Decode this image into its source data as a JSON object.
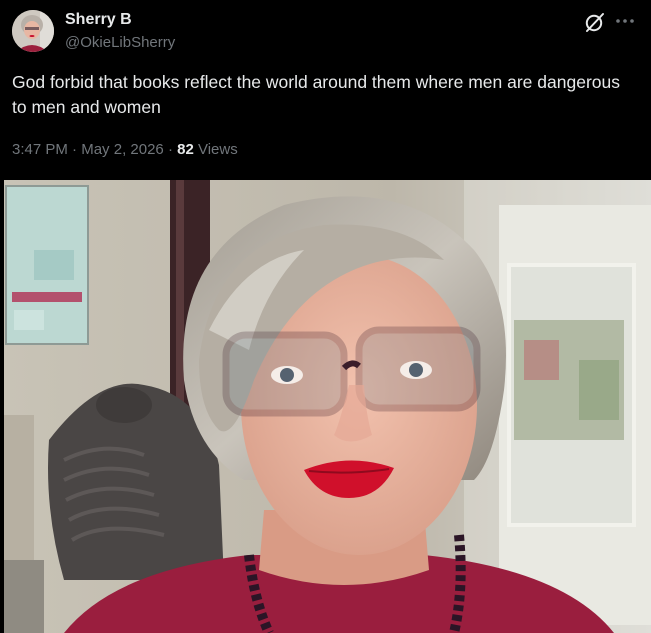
{
  "tweet": {
    "author_name": "Sherry B",
    "author_handle": "@OkieLibSherry",
    "text": "God forbid that books reflect the world around them where men are dangerous to men and women",
    "time": "3:47 PM",
    "separator": "·",
    "date": "May 2, 2026",
    "views_count": "82",
    "views_label": "Views"
  },
  "icons": {
    "grok": "grok-icon",
    "more": "more-icon",
    "avatar": "avatar"
  },
  "colors": {
    "background": "#000000",
    "text_primary": "#e7e9ea",
    "text_secondary": "#71767b"
  }
}
